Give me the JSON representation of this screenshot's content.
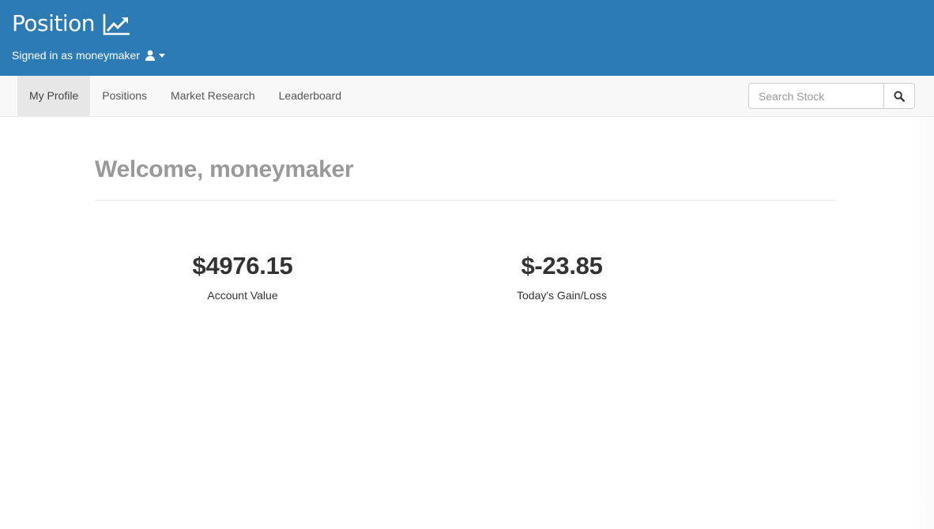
{
  "header": {
    "brand": "Position",
    "brand_icon": "line-chart-icon",
    "signed_in_text": "Signed in as moneymaker",
    "user_icon": "user-icon",
    "caret_icon": "caret-down-icon",
    "background_color": "#2c7bb5"
  },
  "nav": {
    "items": [
      {
        "label": "My Profile",
        "active": true
      },
      {
        "label": "Positions",
        "active": false
      },
      {
        "label": "Market Research",
        "active": false
      },
      {
        "label": "Leaderboard",
        "active": false
      }
    ]
  },
  "search": {
    "placeholder": "Search Stock",
    "value": "",
    "button_icon": "search-icon"
  },
  "main": {
    "title": "Welcome, moneymaker",
    "stats": [
      {
        "value": "$4976.15",
        "label": "Account Value"
      },
      {
        "value": "$-23.85",
        "label": "Today's Gain/Loss"
      }
    ]
  }
}
